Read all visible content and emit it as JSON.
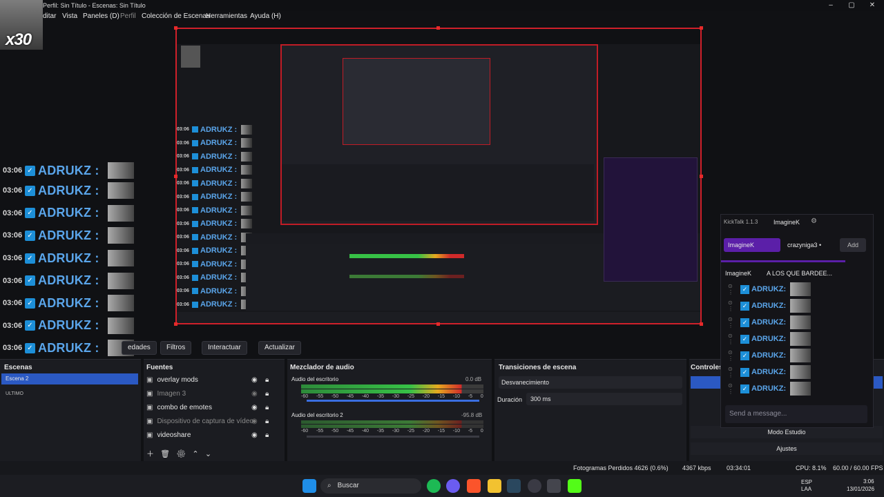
{
  "window": {
    "title": "Perfil: Sin Título - Escenas: Sin Título"
  },
  "menu": [
    "ditar",
    "Vista",
    "Paneles (D)",
    "Perfil",
    "Colección de Escenas",
    "Herramientas",
    "Ayuda (H)"
  ],
  "avatar_text": "x30",
  "chat": {
    "time": "03:06",
    "username": "ADRUKZ :",
    "rows": 14
  },
  "preview_chat": {
    "time": "03:06",
    "username": "ADRUKZ :"
  },
  "toolbar": {
    "properties": "edades",
    "filters": "Filtros",
    "interact": "Interactuar",
    "refresh": "Actualizar"
  },
  "scenes": {
    "header": "Escenas",
    "items": [
      "Escena 2",
      "ULTIMO"
    ]
  },
  "sources": {
    "header": "Fuentes",
    "items": [
      {
        "label": "overlay mods",
        "visible": true
      },
      {
        "label": "Imagen 3",
        "visible": false
      },
      {
        "label": "combo de emotes",
        "visible": true
      },
      {
        "label": "Dispositivo de captura de vídeo",
        "visible": false
      },
      {
        "label": "videoshare",
        "visible": true
      }
    ]
  },
  "mixer": {
    "header": "Mezclador de audio",
    "channels": [
      {
        "name": "Audio del escritorio",
        "db": "0.0 dB"
      },
      {
        "name": "Audio del escritorio 2",
        "db": "-95.8 dB"
      }
    ],
    "scale": [
      "-60",
      "-55",
      "-50",
      "-45",
      "-40",
      "-35",
      "-30",
      "-25",
      "-20",
      "-15",
      "-10",
      "-5",
      "0"
    ]
  },
  "transitions": {
    "header": "Transiciones de escena",
    "selected": "Desvanecimiento",
    "duration_label": "Duración",
    "duration_value": "300 ms"
  },
  "controls": {
    "header": "Controles",
    "studio_mode": "Modo Estudio",
    "settings": "Ajustes"
  },
  "status": {
    "dropped": "Fotogramas Perdidos 4626 (0.6%)",
    "bitrate": "4367 kbps",
    "time": "03:34:01",
    "cpu": "CPU: 8.1%",
    "fps": "60.00 / 60.00 FPS"
  },
  "taskbar": {
    "search": "Buscar",
    "lang": "ESP",
    "lang2": "LAA",
    "clock": "3:06",
    "date": "13/01/2026"
  },
  "kicktalk": {
    "title": "KickTalk 1.1.3",
    "user": "ImagineK",
    "tabs": [
      "ImagineK",
      "crazyniga3 •"
    ],
    "add": "Add",
    "pinned": "A LOS QUE BARDEE...",
    "pinned_user": "ImagineK",
    "row_name": "ADRUKZ:",
    "rows": 7,
    "input_placeholder": "Send a message..."
  },
  "colors": {
    "accent": "#1d8fd8",
    "border_red": "#d0202a",
    "kick_purple": "#5b1fa8"
  }
}
